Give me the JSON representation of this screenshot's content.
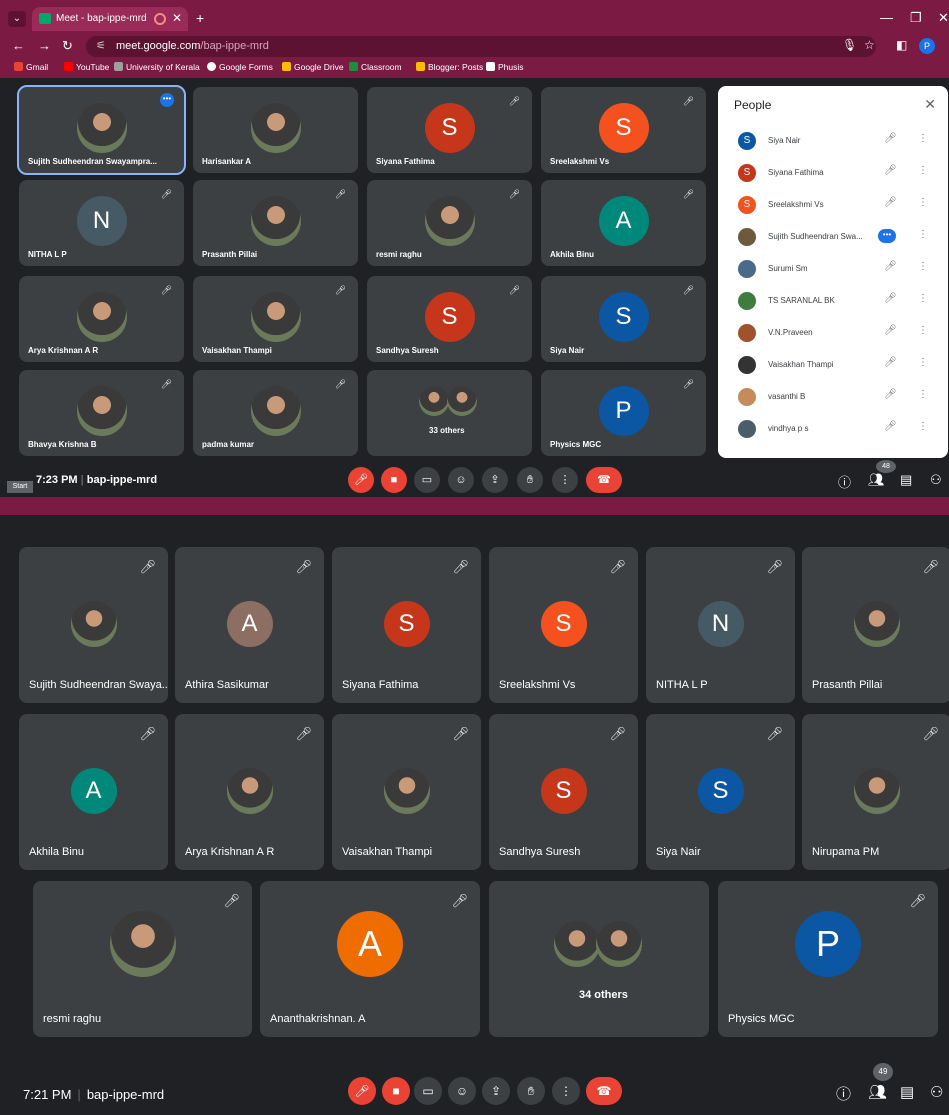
{
  "browser": {
    "tab_title": "Meet - bap-ippe-mrd",
    "url_host": "meet.google.com",
    "url_path": "/bap-ippe-mrd",
    "bookmarks": [
      "Gmail",
      "YouTube",
      "University of Kerala",
      "Google Forms",
      "Google Drive",
      "Classroom",
      "Blogger: Posts",
      "Phusis"
    ],
    "profile_initial": "P"
  },
  "meet1": {
    "tiles": [
      {
        "name": "Sujith Sudheendran Swayampra...",
        "avatar": "photo",
        "selected": true
      },
      {
        "name": "Harisankar A",
        "avatar": "photo"
      },
      {
        "name": "Siyana Fathima",
        "initial": "S",
        "color": "#c5361b"
      },
      {
        "name": "Sreelakshmi Vs",
        "initial": "S",
        "color": "#f4511e"
      },
      {
        "name": "NITHA L P",
        "initial": "N",
        "color": "#455a64"
      },
      {
        "name": "Prasanth Pillai",
        "avatar": "photo"
      },
      {
        "name": "resmi raghu",
        "avatar": "photo"
      },
      {
        "name": "Akhila Binu",
        "initial": "A",
        "color": "#00897b"
      },
      {
        "name": "Arya Krishnan A R",
        "avatar": "photo"
      },
      {
        "name": "Vaisakhan Thampi",
        "avatar": "photo"
      },
      {
        "name": "Sandhya Suresh",
        "initial": "S",
        "color": "#c5361b"
      },
      {
        "name": "Siya Nair",
        "initial": "S",
        "color": "#0b57a4"
      },
      {
        "name": "Bhavya Krishna B",
        "avatar": "photo"
      },
      {
        "name": "padma kumar",
        "avatar": "photo"
      },
      {
        "name": "33 others",
        "avatar": "group"
      },
      {
        "name": "Physics MGC",
        "initial": "P",
        "color": "#0b57a4"
      }
    ],
    "people_panel": {
      "title": "People",
      "entries": [
        {
          "name": "Siya Nair",
          "initial": "S",
          "color": "#0b57a4"
        },
        {
          "name": "Siyana Fathima",
          "initial": "S",
          "color": "#c5361b"
        },
        {
          "name": "Sreelakshmi Vs",
          "initial": "S",
          "color": "#f4511e"
        },
        {
          "name": "Sujith Sudheendran Swa...",
          "initial": "",
          "color": "#6d5a3e",
          "speaking": true
        },
        {
          "name": "Surumi Sm",
          "initial": "",
          "color": "#4a6a8a"
        },
        {
          "name": "TS SARANLAL BK",
          "initial": "",
          "color": "#3f7d3f"
        },
        {
          "name": "V.N.Praveen",
          "initial": "",
          "color": "#a0522d"
        },
        {
          "name": "Vaisakhan Thampi",
          "initial": "",
          "color": "#333333"
        },
        {
          "name": "vasanthi B",
          "initial": "",
          "color": "#c58b5a"
        },
        {
          "name": "vindhya p s",
          "initial": "",
          "color": "#4b5d6b"
        }
      ]
    },
    "time": "7:23 PM",
    "meeting_code": "bap-ippe-mrd",
    "start_label": "Start",
    "participant_count": "48"
  },
  "meet2": {
    "tiles": [
      {
        "name": "Sujith Sudheendran Swaya...",
        "avatar": "photo"
      },
      {
        "name": "Athira Sasikumar",
        "initial": "A",
        "color": "#8d6e63"
      },
      {
        "name": "Siyana Fathima",
        "initial": "S",
        "color": "#c5361b"
      },
      {
        "name": "Sreelakshmi Vs",
        "initial": "S",
        "color": "#f4511e"
      },
      {
        "name": "NITHA L P",
        "initial": "N",
        "color": "#455a64"
      },
      {
        "name": "Prasanth Pillai",
        "avatar": "photo"
      },
      {
        "name": "Akhila Binu",
        "initial": "A",
        "color": "#00897b"
      },
      {
        "name": "Arya Krishnan A R",
        "avatar": "photo"
      },
      {
        "name": "Vaisakhan Thampi",
        "avatar": "photo"
      },
      {
        "name": "Sandhya Suresh",
        "initial": "S",
        "color": "#c5361b"
      },
      {
        "name": "Siya Nair",
        "initial": "S",
        "color": "#0b57a4"
      },
      {
        "name": "Nirupama PM",
        "avatar": "photo"
      },
      {
        "name": "resmi raghu",
        "avatar": "photo"
      },
      {
        "name": "Ananthakrishnan. A",
        "initial": "A",
        "color": "#ef6c00"
      },
      {
        "name": "34 others",
        "avatar": "group"
      },
      {
        "name": "Physics MGC",
        "initial": "P",
        "color": "#0b57a4"
      }
    ],
    "time": "7:21 PM",
    "meeting_code": "bap-ippe-mrd",
    "participant_count": "49"
  },
  "colors": {
    "accent": "#1a73e8",
    "danger": "#ea4335",
    "tile": "#3c4043",
    "background": "#202124",
    "chrome": "#7b1a43"
  },
  "icons": [
    "mic-off-icon",
    "camera-off-icon",
    "captions-icon",
    "emoji-icon",
    "present-icon",
    "raise-hand-icon",
    "more-options-icon",
    "hang-up-icon",
    "info-icon",
    "people-icon",
    "chat-icon",
    "activities-icon"
  ]
}
